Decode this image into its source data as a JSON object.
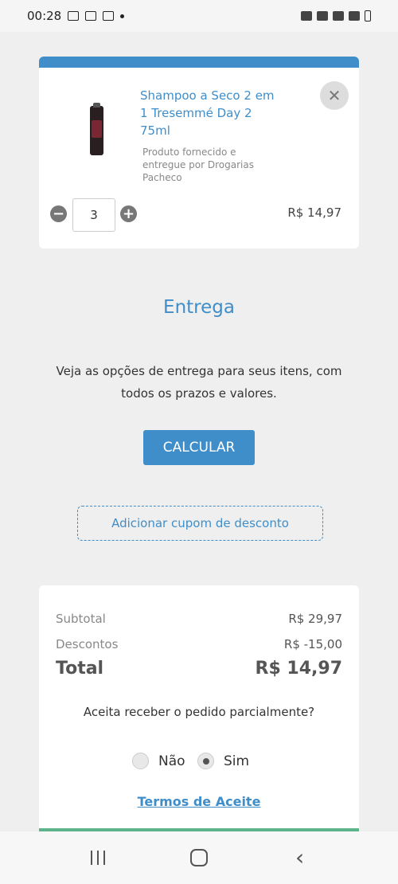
{
  "status_bar": {
    "time": "00:28"
  },
  "product": {
    "name": "Shampoo a Seco 2 em 1 Tresemmé Day 2 75ml",
    "seller": "Produto fornecido e entregue por Drogarias Pacheco",
    "quantity": "3",
    "price": "R$ 14,97",
    "remove_symbol": "✕",
    "minus_symbol": "−",
    "plus_symbol": "+"
  },
  "delivery": {
    "title": "Entrega",
    "description": "Veja as opções de entrega para seus itens, com todos os prazos e valores.",
    "calculate_label": "CALCULAR"
  },
  "coupon": {
    "label": "Adicionar cupom de desconto"
  },
  "summary": {
    "subtotal_label": "Subtotal",
    "subtotal_value": "R$ 29,97",
    "discount_label": "Descontos",
    "discount_value": "R$ -15,00",
    "total_label": "Total",
    "total_value": "R$ 14,97",
    "partial_question": "Aceita receber o pedido parcialmente?",
    "option_no": "Não",
    "option_yes": "Sim",
    "selected": "Sim",
    "terms_label": "Termos de Aceite"
  },
  "nav": {
    "back_symbol": "‹"
  },
  "colors": {
    "accent": "#3f8ec9",
    "background": "#efefef",
    "success_bar": "#5db38a"
  }
}
